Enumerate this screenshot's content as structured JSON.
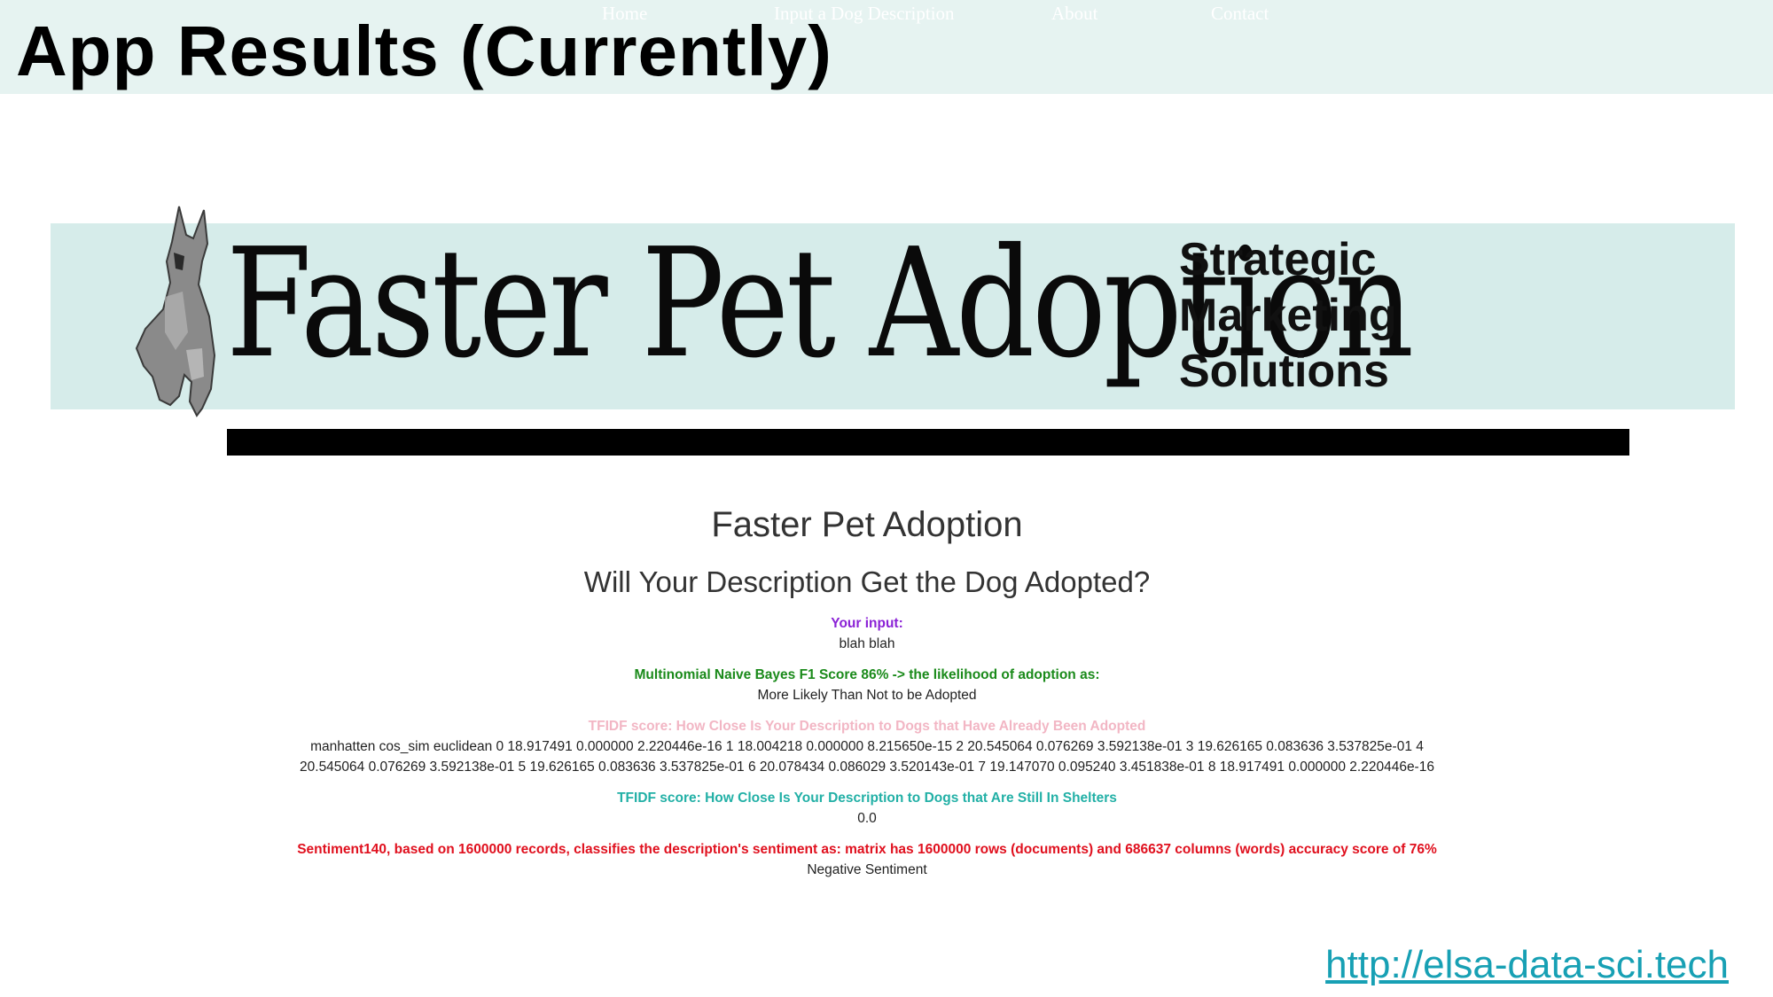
{
  "slide": {
    "title": "App Results (Currently)",
    "footer_link": "http://elsa-data-sci.tech"
  },
  "banner": {
    "title": "Faster Pet Adoption",
    "tagline": [
      "Strategic",
      "Marketing",
      "Solutions"
    ],
    "background_color": "#d6ecea",
    "illustration": "dog-icon"
  },
  "nav": {
    "items": [
      {
        "label": "Home"
      },
      {
        "label": "Input a Dog Description"
      },
      {
        "label": "About"
      },
      {
        "label": "Contact"
      }
    ]
  },
  "main": {
    "heading": "Faster Pet Adoption",
    "subheading": "Will Your Description Get the Dog Adopted?",
    "input_label": "Your input:",
    "input_value": "blah blah",
    "nb_label": "Multinomial Naive Bayes F1 Score 86% -> the likelihood of adoption as:",
    "nb_value": "More Likely Than Not to be Adopted",
    "tfidf_adopted_label": "TFIDF score: How Close Is Your Description to Dogs that Have Already Been Adopted",
    "tfidf_adopted_value": "manhatten cos_sim euclidean 0 18.917491 0.000000 2.220446e-16 1 18.004218 0.000000 8.215650e-15 2 20.545064 0.076269 3.592138e-01 3 19.626165 0.083636 3.537825e-01 4 20.545064 0.076269 3.592138e-01 5 19.626165 0.083636 3.537825e-01 6 20.078434 0.086029 3.520143e-01 7 19.147070 0.095240 3.451838e-01 8 18.917491 0.000000 2.220446e-16",
    "tfidf_shelter_label": "TFIDF score: How Close Is Your Description to Dogs that Are Still In Shelters",
    "tfidf_shelter_value": "0.0",
    "sentiment_label": "Sentiment140, based on 1600000 records, classifies the description's sentiment as: matrix has 1600000 rows (documents) and 686637 columns (words) accuracy score of 76%",
    "sentiment_value": "Negative Sentiment"
  },
  "colors": {
    "title_bar": "#e6f3f1",
    "input_label": "#8b22d6",
    "nb_label": "#1a8a1a",
    "tfidf_adopted_label": "#f2b6c4",
    "tfidf_shelter_label": "#22b0a6",
    "sentiment_label": "#e0101e",
    "footer_link": "#17a0b4"
  }
}
